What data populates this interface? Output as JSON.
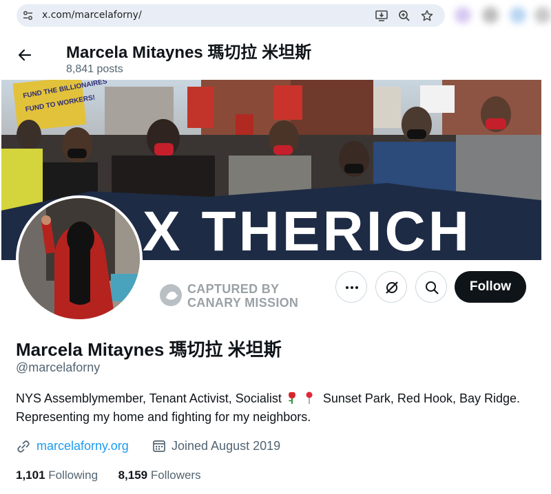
{
  "browser": {
    "url": "x.com/marcelaforny/",
    "icons": [
      "site-info-icon",
      "install-app-icon",
      "zoom-icon",
      "bookmark-star-icon"
    ]
  },
  "header": {
    "display_name": "Marcela Mitaynes 瑪切拉 米坦斯",
    "post_count": "8,841 posts"
  },
  "banner": {
    "protest_sign_text": "X THERICH",
    "sign_text_left": "FUND THE BILLIONAIRES",
    "sign_text_left2": "FUND TO WORKERS!"
  },
  "watermark": {
    "line1": "CAPTURED BY",
    "line2": "CANARY MISSION"
  },
  "actions": {
    "follow_label": "Follow",
    "icons": [
      "more-icon",
      "grok-icon",
      "search-icon"
    ]
  },
  "profile": {
    "name": "Marcela Mitaynes 瑪切拉 米坦斯",
    "handle": "@marcelaforny",
    "bio_part1": "NYS Assemblymember, Tenant Activist, Socialist",
    "bio_part2": " Sunset Park, Red Hook, Bay Ridge. Representing my home and fighting for my neighbors.",
    "website": "marcelaforny.org",
    "joined": "Joined August 2019"
  },
  "stats": {
    "following_count": "1,101",
    "following_label": "Following",
    "followers_count": "8,159",
    "followers_label": "Followers"
  },
  "colors": {
    "accent_link": "#1d9bf0",
    "secondary_text": "#536471",
    "follow_button_bg": "#0f1419"
  }
}
